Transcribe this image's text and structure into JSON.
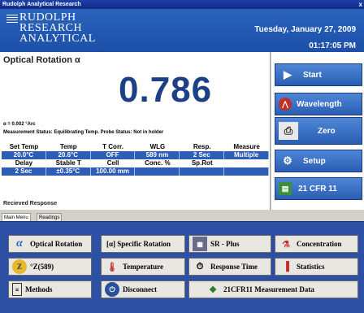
{
  "window": {
    "title": "Rudolph Analytical Research",
    "close": "x"
  },
  "header": {
    "logo_lines": [
      "RUDOLPH",
      "RESEARCH",
      "ANALYTICAL"
    ],
    "date": "Tuesday, January 27, 2009",
    "time": "01:17:05 PM"
  },
  "panel": {
    "title": "Optical Rotation α",
    "value": "0.786",
    "arc": "α = 0.002 °Arc",
    "status": "Measurement Status: Equilibrating Temp.   Probe Status: Not in holder",
    "table": {
      "row1_headers": [
        "Set Temp",
        "Temp",
        "T Corr.",
        "WLG",
        "Resp.",
        "Measure"
      ],
      "row1_values": [
        "20.0°C",
        "20.6°C",
        "OFF",
        "589 nm",
        "2 Sec",
        "Multiple"
      ],
      "row2_headers": [
        "Delay",
        "Stable T",
        "Cell",
        "Conc. %",
        "Sp.Rot",
        ""
      ],
      "row2_values": [
        "2 Sec",
        "±0.35°C",
        "100.00 mm",
        "",
        "",
        ""
      ]
    },
    "received": "Recieved Response"
  },
  "side_buttons": [
    {
      "label": "Start",
      "icon": "play-icon"
    },
    {
      "label": "Wavelength",
      "icon": "wavelength-icon"
    },
    {
      "label": "Zero",
      "icon": "printer-icon"
    },
    {
      "label": "Setup",
      "icon": "gears-icon"
    },
    {
      "label": "21 CFR 11",
      "icon": "book-icon"
    }
  ],
  "tabs": [
    "Main Menu",
    "Readings"
  ],
  "menu": [
    {
      "label": "Optical Rotation",
      "icon": "alpha-icon"
    },
    {
      "label": "[α] Specific Rotation",
      "icon": "bracket-alpha-icon"
    },
    {
      "label": "SR - Plus",
      "icon": "sr-plus-icon"
    },
    {
      "label": "Concentration",
      "icon": "flask-icon"
    },
    {
      "label": "°Z(589)",
      "icon": "z-coin-icon"
    },
    {
      "label": "Temperature",
      "icon": "thermometer-icon"
    },
    {
      "label": "Response Time",
      "icon": "clock-icon"
    },
    {
      "label": "Statistics",
      "icon": "chart-icon"
    },
    {
      "label": "Methods",
      "icon": "document-icon"
    },
    {
      "label": "Disconnect",
      "icon": "disconnect-icon"
    },
    {
      "label": "21CFR11 Measurement Data",
      "icon": "cubes-icon"
    }
  ],
  "colors": {
    "header": "#2a63bd",
    "value": "#1d3f86",
    "button": "#2a5db3",
    "bottom": "#2d4fa4"
  }
}
